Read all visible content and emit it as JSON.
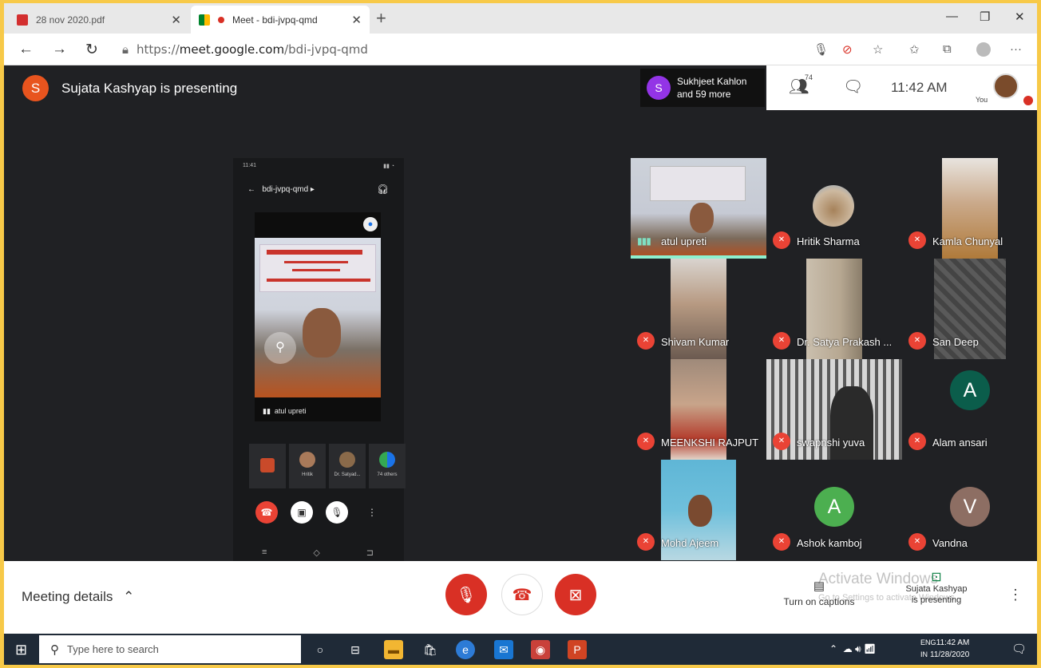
{
  "browser": {
    "tabs": [
      {
        "title": "28 nov 2020.pdf",
        "icon": "pdf-icon"
      },
      {
        "title": "Meet - bdi-jvpq-qmd",
        "icon": "meet-icon"
      }
    ],
    "url_prefix": "https://",
    "url_host": "meet.google.com",
    "url_path": "/bdi-jvpq-qmd"
  },
  "meet": {
    "presenter_initial": "S",
    "presenter_text": "Sujata Kashyap is presenting",
    "others_initial": "S",
    "others_line1": "Sukhjeet Kahlon",
    "others_line2": "and 59 more",
    "people_count": "74",
    "time": "11:42 AM",
    "you_label": "You"
  },
  "phone": {
    "status_left": "11:41",
    "status_right": "",
    "title": "bdi-jvpq-qmd",
    "speaker_name": "atul upreti",
    "thumbs": [
      "",
      "Hritik",
      "Dr. Satyad...",
      "74 others"
    ]
  },
  "tiles": [
    {
      "name": "atul upreti",
      "kind": "video",
      "speaking": true
    },
    {
      "name": "Hritik Sharma",
      "kind": "video"
    },
    {
      "name": "Kamla Chunyal",
      "kind": "video"
    },
    {
      "name": "Shivam Kumar",
      "kind": "video"
    },
    {
      "name": "Dr. Satya Prakash ...",
      "kind": "video"
    },
    {
      "name": "San Deep",
      "kind": "video"
    },
    {
      "name": "MEENKSHI RAJPUT",
      "kind": "video"
    },
    {
      "name": "swapnshi yuva",
      "kind": "video"
    },
    {
      "name": "Alam ansari",
      "kind": "avatar",
      "initial": "A",
      "color": "#0b5d4b"
    },
    {
      "name": "Mohd Ajeem",
      "kind": "video"
    },
    {
      "name": "Ashok kamboj",
      "kind": "avatar",
      "initial": "A",
      "color": "#4caf50"
    },
    {
      "name": "Vandna",
      "kind": "avatar",
      "initial": "V",
      "color": "#8d6e63"
    }
  ],
  "bottom": {
    "details_label": "Meeting details",
    "captions_label": "Turn on captions",
    "present_line1": "Sujata Kashyap",
    "present_line2": "is presenting",
    "watermark1": "Activate Windows",
    "watermark2": "Go to Settings to activate Windows."
  },
  "taskbar": {
    "search_placeholder": "Type here to search",
    "lang1": "ENG",
    "lang2": "IN",
    "time": "11:42 AM",
    "date": "11/28/2020"
  },
  "colors": {
    "accent_red": "#d93025",
    "meet_bg": "#202124",
    "frame_border": "#f7c948"
  }
}
